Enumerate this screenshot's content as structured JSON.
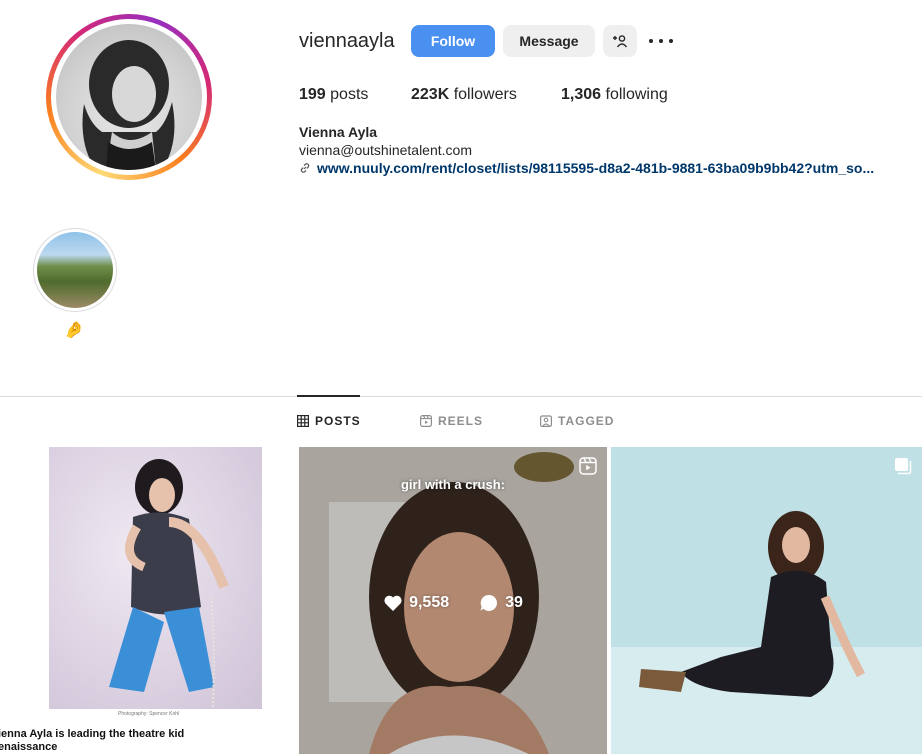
{
  "profile": {
    "username": "viennaayla",
    "follow_label": "Follow",
    "message_label": "Message",
    "stats": {
      "posts_count": "199",
      "posts_label": "posts",
      "followers_count": "223K",
      "followers_label": "followers",
      "following_count": "1,306",
      "following_label": "following"
    },
    "display_name": "Vienna Ayla",
    "email": "vienna@outshinetalent.com",
    "link": "www.nuuly.com/rent/closet/lists/98115595-d8a2-481b-9881-63ba09b9bb42?utm_so..."
  },
  "highlight": {
    "emoji": "🤌"
  },
  "tabs": [
    {
      "label": "POSTS",
      "icon": "grid-icon",
      "active": true
    },
    {
      "label": "REELS",
      "icon": "reels-icon",
      "active": false
    },
    {
      "label": "TAGGED",
      "icon": "tagged-icon",
      "active": false
    }
  ],
  "posts": [
    {
      "caption": "ienna Ayla is leading the theatre kid\nenaissance",
      "credit": "Photography: Spencer Kohl"
    },
    {
      "overlay_text": "girl with a crush:",
      "likes": "9,558",
      "comments": "39",
      "type_icon": "reel-icon"
    },
    {
      "type_icon": "multi-image-icon"
    }
  ],
  "colors": {
    "accent": "#4a90f0",
    "link": "#00376b",
    "text": "#262626",
    "muted": "#8e8e8e"
  }
}
